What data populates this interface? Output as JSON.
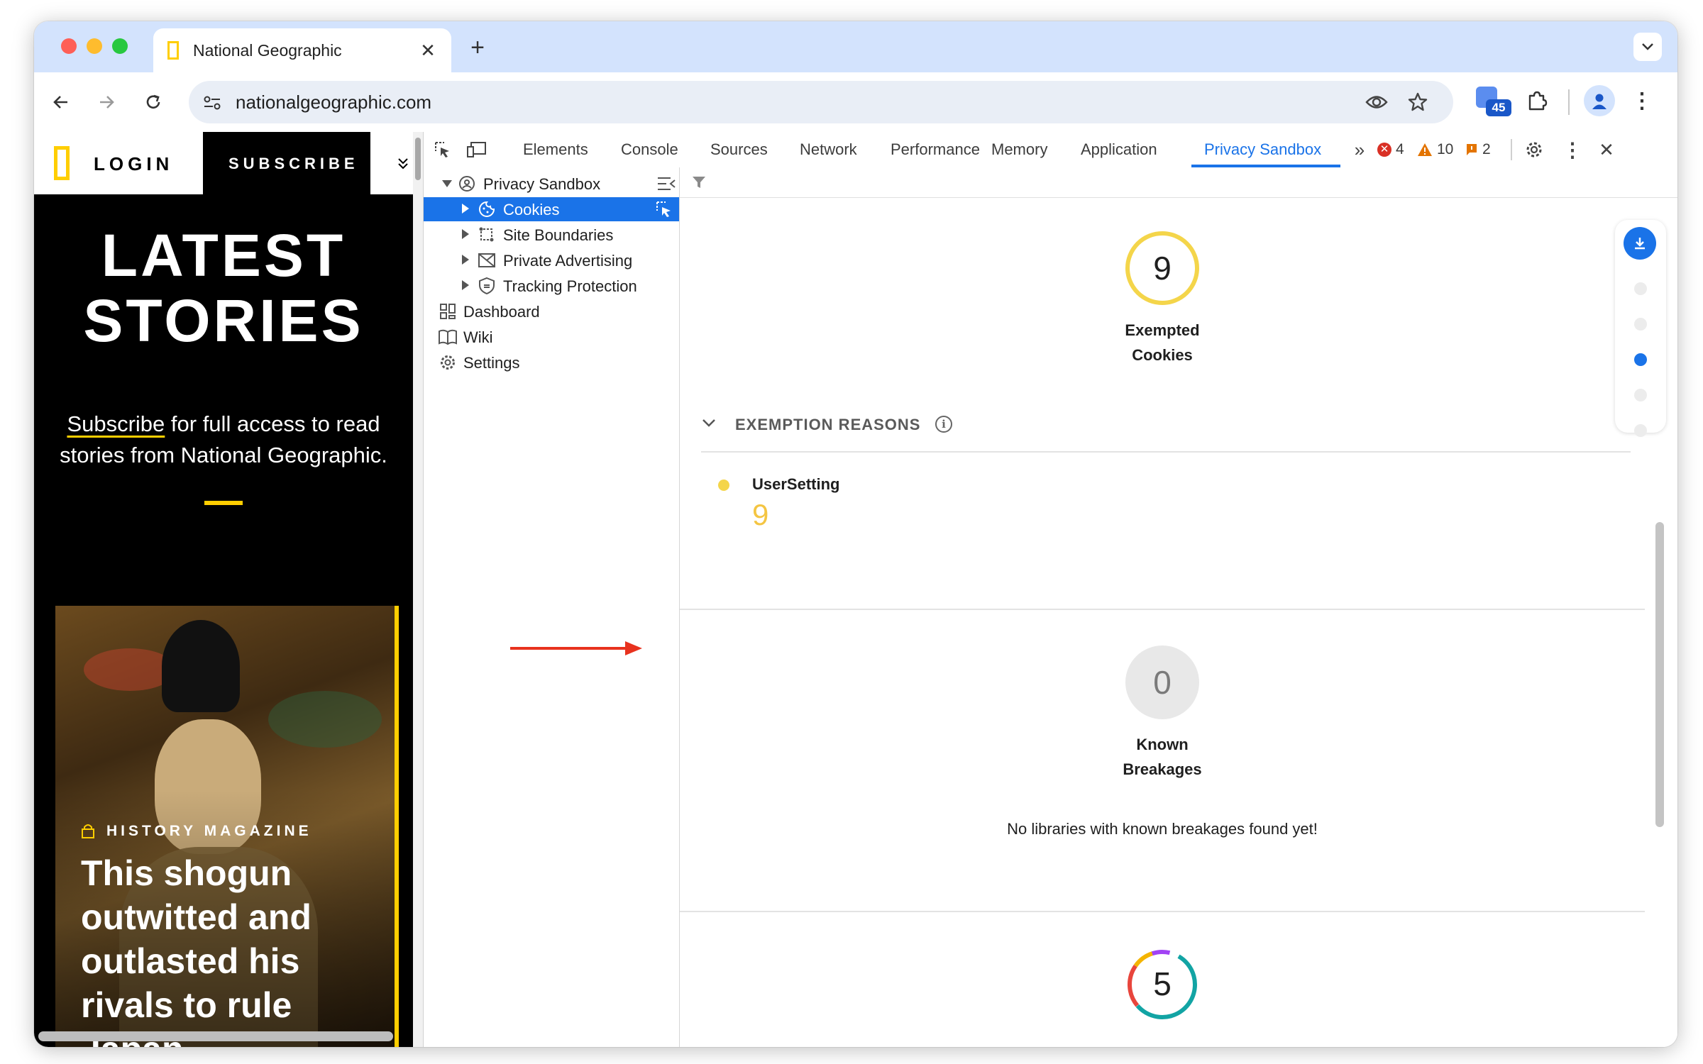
{
  "browser": {
    "tab_title": "National Geographic",
    "url": "nationalgeographic.com",
    "extension_badge": "45"
  },
  "page": {
    "login_label": "LOGIN",
    "subscribe_label": "SUBSCRIBE",
    "hero_title_line1": "LATEST",
    "hero_title_line2": "STORIES",
    "subscribe_link": "Subscribe",
    "promo_rest_line1": " for full access to read",
    "promo_line2": "stories from National Geographic.",
    "card_category": "HISTORY MAGAZINE",
    "card_title_lines": [
      "This shogun",
      "outwitted and",
      "outlasted his",
      "rivals to rule",
      "Japan"
    ]
  },
  "devtools": {
    "tabs": [
      "Elements",
      "Console",
      "Sources",
      "Network",
      "Performance",
      "Memory",
      "Application",
      "Privacy Sandbox"
    ],
    "active_tab": "Privacy Sandbox",
    "errors": "4",
    "warnings": "10",
    "issues": "2",
    "sidebar": {
      "root": "Privacy Sandbox",
      "items": [
        "Cookies",
        "Site Boundaries",
        "Private Advertising",
        "Tracking Protection"
      ],
      "bottom_items": [
        "Dashboard",
        "Wiki",
        "Settings"
      ],
      "selected": "Cookies"
    },
    "main": {
      "exempted": {
        "count": "9",
        "label_line1": "Exempted",
        "label_line2": "Cookies"
      },
      "exemption_reasons_title": "EXEMPTION REASONS",
      "reasons": [
        {
          "name": "UserSetting",
          "count": "9"
        }
      ],
      "breakages": {
        "count": "0",
        "label_line1": "Known",
        "label_line2": "Breakages",
        "message": "No libraries with known breakages found yet!"
      },
      "third": {
        "count": "5"
      }
    }
  },
  "colors": {
    "accent_blue": "#1a73e8",
    "natgeo_yellow": "#ffce00",
    "error_red": "#d93025",
    "warn_orange": "#e37400",
    "ring_yellow": "#f4d54a",
    "selected_row": "#1a73e8"
  }
}
